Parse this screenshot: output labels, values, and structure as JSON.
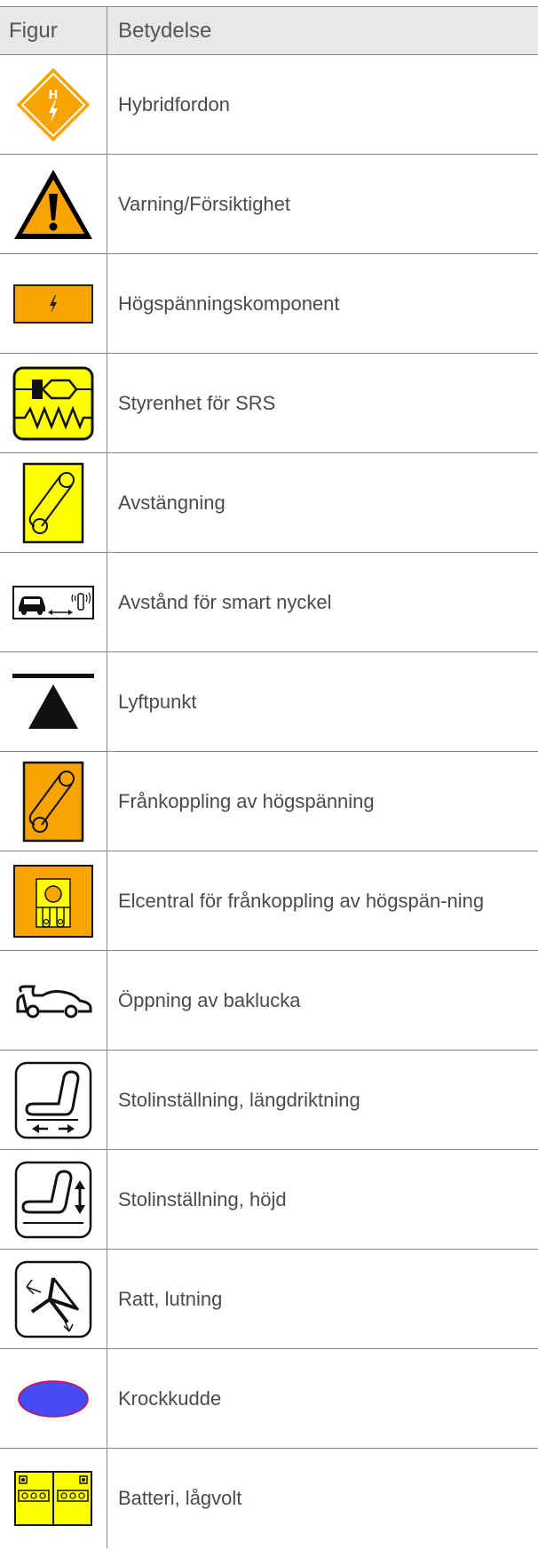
{
  "header": {
    "figure_label": "Figur",
    "meaning_label": "Betydelse"
  },
  "rows": [
    {
      "icon": "hybrid-vehicle-icon",
      "label": "Hybridfordon"
    },
    {
      "icon": "warning-triangle-icon",
      "label": "Varning/Försiktighet"
    },
    {
      "icon": "high-voltage-component-icon",
      "label": "Högspänningskomponent"
    },
    {
      "icon": "srs-control-unit-icon",
      "label": "Styrenhet för SRS"
    },
    {
      "icon": "shutdown-icon",
      "label": "Avstängning"
    },
    {
      "icon": "smart-key-distance-icon",
      "label": "Avstånd för smart nyckel"
    },
    {
      "icon": "lift-point-icon",
      "label": "Lyftpunkt"
    },
    {
      "icon": "high-voltage-disconnect-icon",
      "label": "Frånkoppling av högspänning"
    },
    {
      "icon": "disconnect-fuse-box-icon",
      "label": "Elcentral för frånkoppling av högspän-ning"
    },
    {
      "icon": "trunk-open-icon",
      "label": "Öppning av baklucka"
    },
    {
      "icon": "seat-longitudinal-icon",
      "label": "Stolinställning, längdriktning"
    },
    {
      "icon": "seat-height-icon",
      "label": "Stolinställning, höjd"
    },
    {
      "icon": "steering-wheel-tilt-icon",
      "label": "Ratt, lutning"
    },
    {
      "icon": "airbag-icon",
      "label": "Krockkudde"
    },
    {
      "icon": "low-voltage-battery-icon",
      "label": "Batteri, lågvolt"
    }
  ],
  "colors": {
    "orange": "#f7a400",
    "yellow": "#ffff00",
    "airbag_blue": "#4a4af5",
    "airbag_outline": "#d0103a"
  }
}
